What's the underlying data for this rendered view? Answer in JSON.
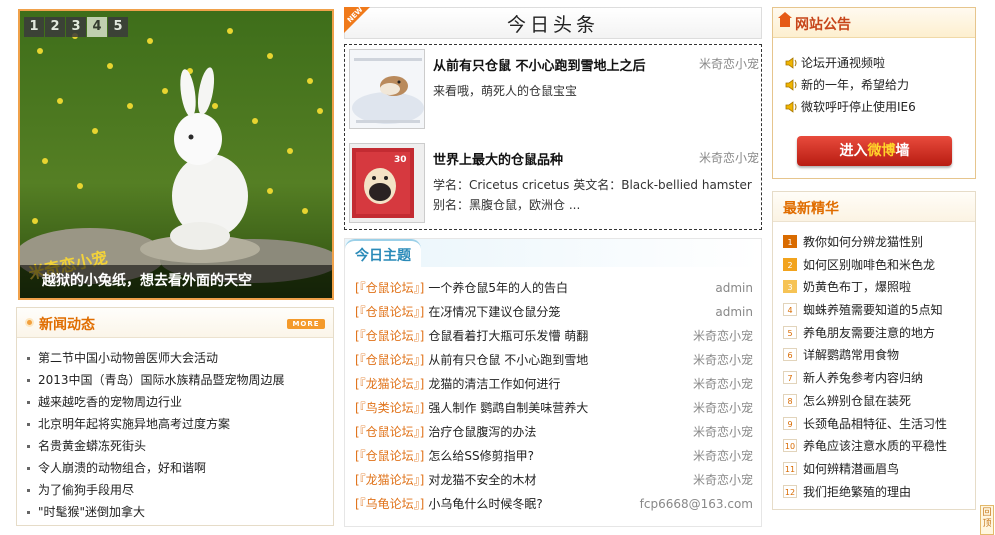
{
  "slideshow": {
    "tabs": [
      "1",
      "2",
      "3",
      "4",
      "5"
    ],
    "active_tab": "4",
    "caption": "越狱的小兔纸，想去看外面的天空",
    "watermark": "米奇恋小宠"
  },
  "news": {
    "title": "新闻动态",
    "more": "MORE",
    "items": [
      "第二节中国小动物兽医师大会活动",
      "2013中国（青岛）国际水族精品暨宠物周边展",
      "越来越吃香的宠物周边行业",
      "北京明年起将实施异地高考过度方案",
      "名贵黄金蟒冻死街头",
      "令人崩溃的动物组合，好和谐啊",
      "为了偷狗手段用尽",
      "\"时髦猴\"迷倒加拿大"
    ]
  },
  "headline": {
    "badge": "NEW",
    "title": "今日头条",
    "features": [
      {
        "title": "从前有只仓鼠 不小心跑到雪地上之后",
        "author": "米奇恋小宠",
        "desc": "来看哦，萌死人的仓鼠宝宝"
      },
      {
        "title": "世界上最大的仓鼠品种",
        "author": "米奇恋小宠",
        "desc": "学名：Cricetus cricetus 英文名：Black-bellied hamster 别名：黑腹仓鼠，欧洲仓 ..."
      }
    ]
  },
  "topics": {
    "title": "今日主题",
    "items": [
      {
        "cat": "[『仓鼠论坛』]",
        "title": "一个养仓鼠5年的人的告白",
        "author": "admin"
      },
      {
        "cat": "[『仓鼠论坛』]",
        "title": "在冴情况下建议仓鼠分笼",
        "author": "admin"
      },
      {
        "cat": "[『仓鼠论坛』]",
        "title": "仓鼠看着打大瓶可乐发懵 萌翻",
        "author": "米奇恋小宠"
      },
      {
        "cat": "[『仓鼠论坛』]",
        "title": "从前有只仓鼠 不小心跑到雪地",
        "author": "米奇恋小宠"
      },
      {
        "cat": "[『龙猫论坛』]",
        "title": "龙猫的清洁工作如何进行",
        "author": "米奇恋小宠"
      },
      {
        "cat": "[『鸟类论坛』]",
        "title": "强人制作 鹦鹉自制美味营养大",
        "author": "米奇恋小宠"
      },
      {
        "cat": "[『仓鼠论坛』]",
        "title": "治疗仓鼠腹泻的办法",
        "author": "米奇恋小宠"
      },
      {
        "cat": "[『仓鼠论坛』]",
        "title": "怎么给SS修剪指甲?",
        "author": "米奇恋小宠"
      },
      {
        "cat": "[『龙猫论坛』]",
        "title": "对龙猫不安全的木材",
        "author": "米奇恋小宠"
      },
      {
        "cat": "[『乌龟论坛』]",
        "title": "小乌龟什么时候冬眠?",
        "author": "fcp6668@163.com"
      }
    ]
  },
  "notice": {
    "title": "网站公告",
    "items": [
      "论坛开通视频啦",
      "新的一年，希望给力",
      "微软呼吁停止使用IE6"
    ],
    "button_prefix": "进入",
    "button_highlight": "微博",
    "button_suffix": "墙"
  },
  "ranking": {
    "title": "最新精华",
    "items": [
      {
        "num": "1",
        "text": "教你如何分辨龙猫性别"
      },
      {
        "num": "2",
        "text": "如何区别咖啡色和米色龙"
      },
      {
        "num": "3",
        "text": "奶黄色布丁，爆照啦"
      },
      {
        "num": "4",
        "text": "蜘蛛养殖需要知道的5点知"
      },
      {
        "num": "5",
        "text": "养龟朋友需要注意的地方"
      },
      {
        "num": "6",
        "text": "详解鹦鹉常用食物"
      },
      {
        "num": "7",
        "text": "新人养兔参考内容归纳"
      },
      {
        "num": "8",
        "text": "怎么辨别仓鼠在装死"
      },
      {
        "num": "9",
        "text": "长颈龟品相特征、生活习性"
      },
      {
        "num": "10",
        "text": "养龟应该注意水质的平稳性"
      },
      {
        "num": "11",
        "text": "如何辨精潜画眉鸟"
      },
      {
        "num": "12",
        "text": "我们拒绝繁殖的理由"
      }
    ]
  },
  "back_to_top": "回顶"
}
